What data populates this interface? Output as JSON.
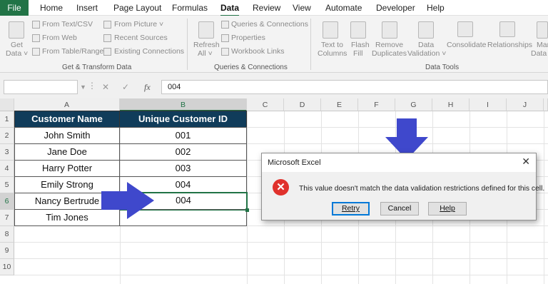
{
  "tabs": [
    "File",
    "Home",
    "Insert",
    "Page Layout",
    "Formulas",
    "Data",
    "Review",
    "View",
    "Automate",
    "Developer",
    "Help"
  ],
  "ribbon": {
    "get_data": [
      "Get",
      "Data ˅"
    ],
    "from_text_csv": "From Text/CSV",
    "from_web": "From Web",
    "from_table_range": "From Table/Range",
    "from_picture": "From Picture ˅",
    "recent_sources": "Recent Sources",
    "existing_connections": "Existing Connections",
    "group_get_transform": "Get & Transform Data",
    "refresh_all": [
      "Refresh",
      "All ˅"
    ],
    "queries_connections": "Queries & Connections",
    "properties": "Properties",
    "workbook_links": "Workbook Links",
    "group_queries": "Queries & Connections",
    "text_to_columns": [
      "Text to",
      "Columns"
    ],
    "flash_fill": [
      "Flash",
      "Fill"
    ],
    "remove_duplicates": [
      "Remove",
      "Duplicates"
    ],
    "data_validation": [
      "Data",
      "Validation ˅"
    ],
    "consolidate": "Consolidate",
    "relationships": "Relationships",
    "manage_data_model": [
      "Man",
      "Data M"
    ],
    "group_data_tools": "Data Tools"
  },
  "formula_bar": {
    "name_box": "",
    "fx": "fx",
    "value": "004"
  },
  "columns": [
    "A",
    "B",
    "C",
    "D",
    "E",
    "F",
    "G",
    "H",
    "I",
    "J"
  ],
  "rows": [
    "1",
    "2",
    "3",
    "4",
    "5",
    "6",
    "7",
    "8",
    "9",
    "10"
  ],
  "table": {
    "headers": [
      "Customer Name",
      "Unique Customer ID"
    ],
    "rows": [
      [
        "John Smith",
        "001"
      ],
      [
        "Jane Doe",
        "002"
      ],
      [
        "Harry Potter",
        "003"
      ],
      [
        "Emily Strong",
        "004"
      ],
      [
        "Nancy Bertrude",
        "004"
      ],
      [
        "Tim Jones",
        ""
      ]
    ]
  },
  "dialog": {
    "title": "Microsoft Excel",
    "close": "✕",
    "icon": "✕",
    "message": "This value doesn't match the data validation restrictions defined for this cell.",
    "buttons": {
      "retry": "Retry",
      "cancel": "Cancel",
      "help": "Help"
    }
  },
  "colors": {
    "excel_green": "#217346",
    "header_fill": "#103c5a",
    "arrow": "#3f48cc",
    "error_red": "#e0312c"
  }
}
